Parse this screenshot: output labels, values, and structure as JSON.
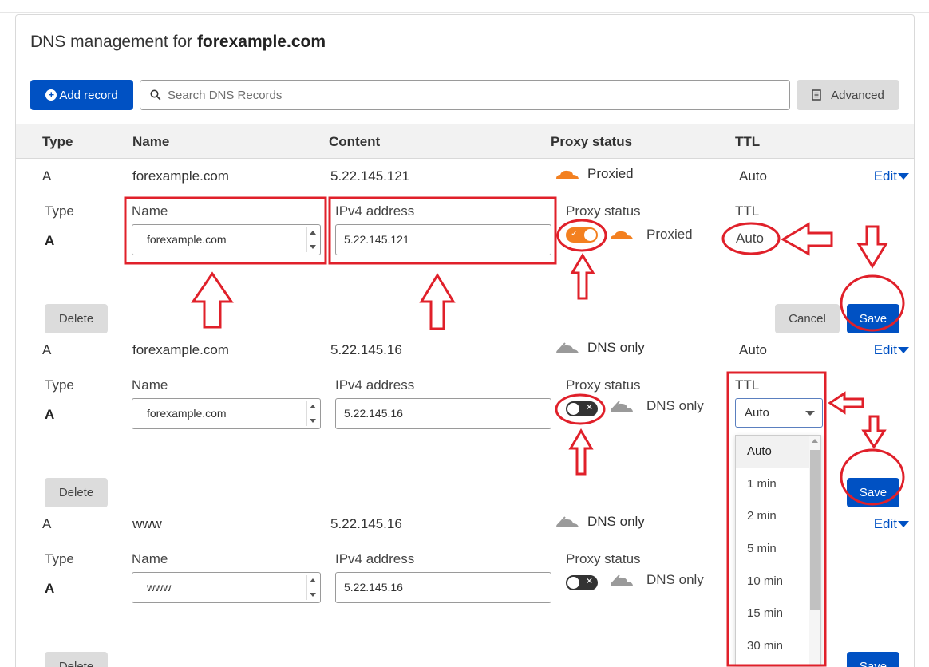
{
  "header": {
    "title_prefix": "DNS management for ",
    "domain": "forexample.com",
    "add_record_label": "Add record",
    "search_placeholder": "Search DNS Records",
    "advanced_label": "Advanced"
  },
  "table": {
    "columns": [
      "Type",
      "Name",
      "Content",
      "Proxy status",
      "TTL"
    ],
    "edit_label": "Edit"
  },
  "records": [
    {
      "type": "A",
      "name": "forexample.com",
      "content": "5.22.145.121",
      "proxy": "Proxied",
      "ttl": "Auto"
    },
    {
      "type": "A",
      "name": "forexample.com",
      "content": "5.22.145.16",
      "proxy": "DNS only",
      "ttl": "Auto"
    },
    {
      "type": "A",
      "name": "www",
      "content": "5.22.145.16",
      "proxy": "DNS only"
    }
  ],
  "edit_labels": {
    "type": "Type",
    "name": "Name",
    "ipv4": "IPv4 address",
    "proxy_status": "Proxy status",
    "ttl": "TTL",
    "delete": "Delete",
    "cancel": "Cancel",
    "save": "Save"
  },
  "panels": [
    {
      "type": "A",
      "name": "forexample.com",
      "ipv4": "5.22.145.121",
      "proxy_on": true,
      "proxy": "Proxied",
      "ttl": "Auto"
    },
    {
      "type": "A",
      "name": "forexample.com",
      "ipv4": "5.22.145.16",
      "proxy_on": false,
      "proxy": "DNS only",
      "ttl": "Auto"
    },
    {
      "type": "A",
      "name": "www",
      "ipv4": "5.22.145.16",
      "proxy_on": false,
      "proxy": "DNS only"
    }
  ],
  "ttl_options": [
    "Auto",
    "1 min",
    "2 min",
    "5 min",
    "10 min",
    "15 min",
    "30 min"
  ],
  "colors": {
    "accent": "#0051c3",
    "proxy_orange": "#f38020",
    "annotation_red": "#e0202a"
  },
  "icons": {
    "add": "plus-circle-icon",
    "search": "search-icon",
    "advanced": "document-icon",
    "proxied": "orange-cloud-icon",
    "dns_only": "gray-cloud-icon"
  }
}
